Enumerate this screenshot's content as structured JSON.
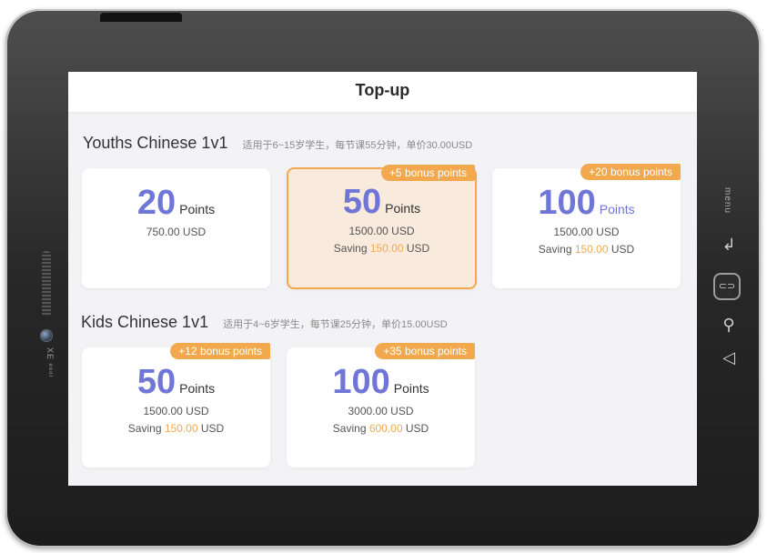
{
  "device": {
    "menu_label": "menu",
    "brand": "ХЕ ᵉᵒᵒˡ"
  },
  "screen": {
    "title": "Top-up",
    "sections": [
      {
        "title": "Youths Chinese 1v1",
        "desc": "适用于6~15岁学生，每节课55分钟，单价30.00USD",
        "cards": [
          {
            "points": "20",
            "points_label": "Points",
            "price": "750.00 USD",
            "badge": "",
            "saving_prefix": "",
            "saving_amount": "",
            "saving_suffix": ""
          },
          {
            "points": "50",
            "points_label": "Points",
            "price": "1500.00 USD",
            "badge": "+5 bonus points",
            "saving_prefix": "Saving ",
            "saving_amount": "150.00",
            "saving_suffix": " USD",
            "selected": true
          },
          {
            "points": "100",
            "points_label": "Points",
            "price": "1500.00 USD",
            "badge": "+20 bonus points",
            "saving_prefix": "Saving ",
            "saving_amount": "150.00",
            "saving_suffix": " USD"
          }
        ]
      },
      {
        "title": "Kids Chinese 1v1",
        "desc": "适用于4~6岁学生，每节课25分钟，单价15.00USD",
        "cards": [
          {
            "points": "50",
            "points_label": "Points",
            "price": "1500.00 USD",
            "badge": "+12 bonus points",
            "saving_prefix": "Saving ",
            "saving_amount": "150.00",
            "saving_suffix": " USD"
          },
          {
            "points": "100",
            "points_label": "Points",
            "price": "3000.00 USD",
            "badge": "+35 bonus points",
            "saving_prefix": "Saving ",
            "saving_amount": "600.00",
            "saving_suffix": " USD"
          }
        ]
      }
    ]
  },
  "colors": {
    "accent_blue": "#6f76d6",
    "accent_orange": "#f2a94e",
    "selected_bg": "#f8eadc"
  },
  "icons": {
    "back": "back-arrow-icon",
    "home": "home-button-icon",
    "search": "search-icon",
    "return": "return-icon"
  }
}
